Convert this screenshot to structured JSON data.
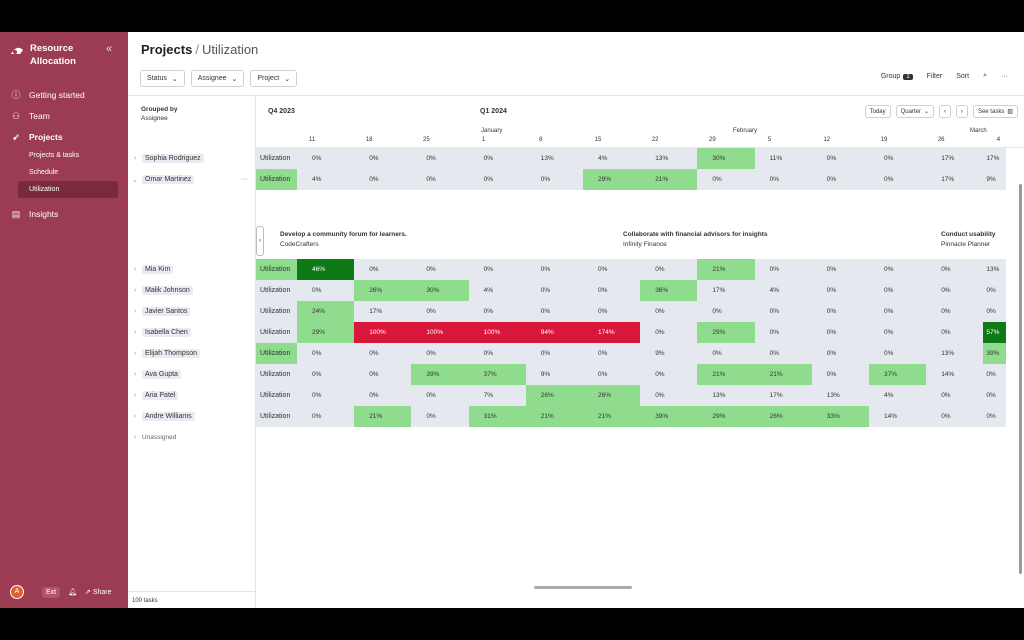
{
  "brand": {
    "title": "Resource Allocation"
  },
  "nav": {
    "getting_started": "Getting started",
    "team": "Team",
    "projects": "Projects",
    "projects_tasks": "Projects & tasks",
    "schedule": "Schedule",
    "utilization": "Utilization",
    "insights": "Insights"
  },
  "footer": {
    "avatar": "A",
    "ext": "Ext",
    "share": "Share"
  },
  "header": {
    "title": "Projects",
    "subtitle": "Utilization",
    "filters": [
      "Status",
      "Assignee",
      "Project"
    ],
    "group": "Group",
    "group_count": "1",
    "filter": "Filter",
    "sort": "Sort"
  },
  "left": {
    "grouped_by": "Grouped by",
    "grouped_field": "Assignee",
    "unassigned": "Unassigned",
    "tasks_count": "100 tasks"
  },
  "timeline": {
    "quarters": [
      "Q4 2023",
      "Q1 2024"
    ],
    "months": [
      "January",
      "February",
      "March"
    ],
    "weeks": [
      "11",
      "18",
      "25",
      "1",
      "8",
      "15",
      "22",
      "29",
      "5",
      "12",
      "19",
      "26",
      "4"
    ],
    "today": "Today",
    "zoom": "Quarter",
    "see_tasks": "See tasks",
    "row_label": "Utilization"
  },
  "colors": {
    "zero": "#e5e8ee",
    "light": "#8fdc8f",
    "dark": "#0e7a16",
    "over": "#d9173a"
  },
  "people": [
    {
      "name": "Sophia Rodriguez",
      "cells": [
        "0%",
        "0%",
        "0%",
        "0%",
        "13%",
        "4%",
        "13%",
        "30%",
        "11%",
        "0%",
        "0%",
        "17%",
        "17%"
      ],
      "tones": [
        "z",
        "z",
        "z",
        "z",
        "z",
        "z",
        "z",
        "l",
        "z",
        "z",
        "z",
        "z",
        "z"
      ]
    },
    {
      "name": "Omar Martinez",
      "cells": [
        "4%",
        "0%",
        "0%",
        "0%",
        "0%",
        "29%",
        "21%",
        "0%",
        "0%",
        "0%",
        "0%",
        "17%",
        "9%"
      ],
      "tones": [
        "z",
        "z",
        "z",
        "z",
        "z",
        "l",
        "l",
        "z",
        "z",
        "z",
        "z",
        "z",
        "z"
      ]
    },
    {
      "name": "Mia Kim",
      "cells": [
        "46%",
        "0%",
        "0%",
        "0%",
        "0%",
        "0%",
        "0%",
        "21%",
        "0%",
        "0%",
        "0%",
        "0%",
        "13%"
      ],
      "tones": [
        "d",
        "z",
        "z",
        "z",
        "z",
        "z",
        "z",
        "l",
        "z",
        "z",
        "z",
        "z",
        "z"
      ]
    },
    {
      "name": "Malik Johnson",
      "cells": [
        "0%",
        "26%",
        "30%",
        "4%",
        "0%",
        "0%",
        "36%",
        "17%",
        "4%",
        "0%",
        "0%",
        "0%",
        "0%"
      ],
      "tones": [
        "z",
        "l",
        "l",
        "z",
        "z",
        "z",
        "l",
        "z",
        "z",
        "z",
        "z",
        "z",
        "z"
      ]
    },
    {
      "name": "Javier Santos",
      "cells": [
        "24%",
        "17%",
        "0%",
        "0%",
        "0%",
        "0%",
        "0%",
        "0%",
        "0%",
        "0%",
        "0%",
        "0%",
        "0%"
      ],
      "tones": [
        "l",
        "z",
        "z",
        "z",
        "z",
        "z",
        "z",
        "z",
        "z",
        "z",
        "z",
        "z",
        "z"
      ]
    },
    {
      "name": "Isabella Chen",
      "cells": [
        "29%",
        "100%",
        "100%",
        "100%",
        "94%",
        "174%",
        "0%",
        "29%",
        "0%",
        "0%",
        "0%",
        "0%",
        "57%"
      ],
      "tones": [
        "l",
        "o",
        "o",
        "o",
        "o",
        "o",
        "z",
        "l",
        "z",
        "z",
        "z",
        "z",
        "d"
      ]
    },
    {
      "name": "Elijah Thompson",
      "cells": [
        "0%",
        "0%",
        "0%",
        "0%",
        "0%",
        "0%",
        "9%",
        "0%",
        "0%",
        "0%",
        "0%",
        "13%",
        "39%"
      ],
      "tones": [
        "z",
        "z",
        "z",
        "z",
        "z",
        "z",
        "z",
        "z",
        "z",
        "z",
        "z",
        "z",
        "l"
      ]
    },
    {
      "name": "Ava Gupta",
      "cells": [
        "0%",
        "0%",
        "39%",
        "37%",
        "9%",
        "0%",
        "0%",
        "21%",
        "21%",
        "0%",
        "37%",
        "14%",
        "0%"
      ],
      "tones": [
        "z",
        "z",
        "l",
        "l",
        "z",
        "z",
        "z",
        "l",
        "l",
        "z",
        "l",
        "z",
        "z"
      ]
    },
    {
      "name": "Aria Patel",
      "cells": [
        "0%",
        "0%",
        "0%",
        "7%",
        "26%",
        "26%",
        "0%",
        "13%",
        "17%",
        "13%",
        "4%",
        "0%",
        "0%"
      ],
      "tones": [
        "z",
        "z",
        "z",
        "z",
        "l",
        "l",
        "z",
        "z",
        "z",
        "z",
        "z",
        "z",
        "z"
      ]
    },
    {
      "name": "Andre Williams",
      "cells": [
        "0%",
        "21%",
        "0%",
        "31%",
        "21%",
        "21%",
        "39%",
        "29%",
        "26%",
        "33%",
        "14%",
        "0%",
        "0%"
      ],
      "tones": [
        "z",
        "l",
        "z",
        "l",
        "l",
        "l",
        "l",
        "l",
        "l",
        "l",
        "z",
        "z",
        "z"
      ]
    }
  ],
  "task_cards": [
    {
      "title": "Develop a community forum for learners.",
      "project": "CodeCrafters"
    },
    {
      "title": "Collaborate with financial advisors for insights",
      "project": "Infinity Finance"
    },
    {
      "title": "Conduct usability",
      "project": "Pinnacle Planner"
    }
  ]
}
